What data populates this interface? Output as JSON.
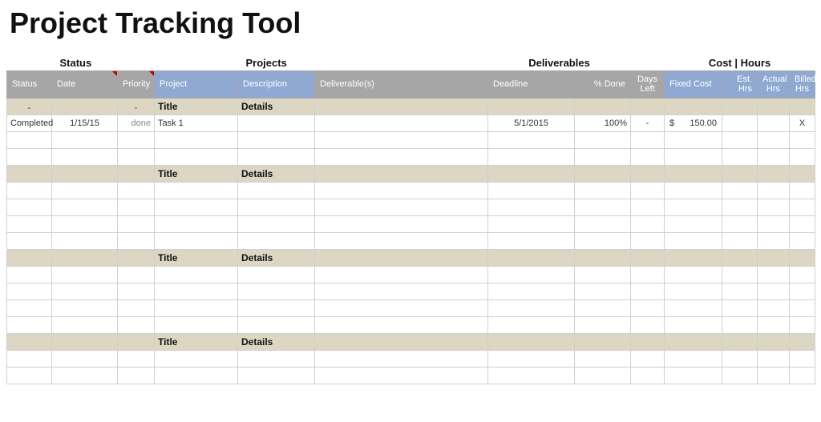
{
  "title": "Project Tracking Tool",
  "group_labels": {
    "status": "Status",
    "projects": "Projects",
    "deliverables": "Deliverables",
    "cost_hours": "Cost | Hours"
  },
  "columns": {
    "status": "Status",
    "date": "Date",
    "priority": "Priority",
    "project": "Project",
    "description": "Description",
    "deliverables": "Deliverable(s)",
    "deadline": "Deadline",
    "pct_done": "% Done",
    "days_left": "Days Left",
    "fixed_cost": "Fixed Cost",
    "est_hrs": "Est. Hrs",
    "actual_hrs": "Actual Hrs",
    "billed_hrs": "Billed Hrs"
  },
  "section1": {
    "header": {
      "status_dash": "-",
      "priority_dash": "-",
      "title": "Title",
      "details": "Details"
    },
    "row": {
      "status": "Completed",
      "date": "1/15/15",
      "priority": "done",
      "project": "Task 1",
      "description": "",
      "deliverables": "",
      "deadline": "5/1/2015",
      "pct_done": "100%",
      "days_left": "-",
      "cost_sym": "$",
      "cost_val": "150.00",
      "est_hrs": "",
      "actual_hrs": "",
      "billed_hrs": "X"
    }
  },
  "section_generic": {
    "title": "Title",
    "details": "Details"
  }
}
